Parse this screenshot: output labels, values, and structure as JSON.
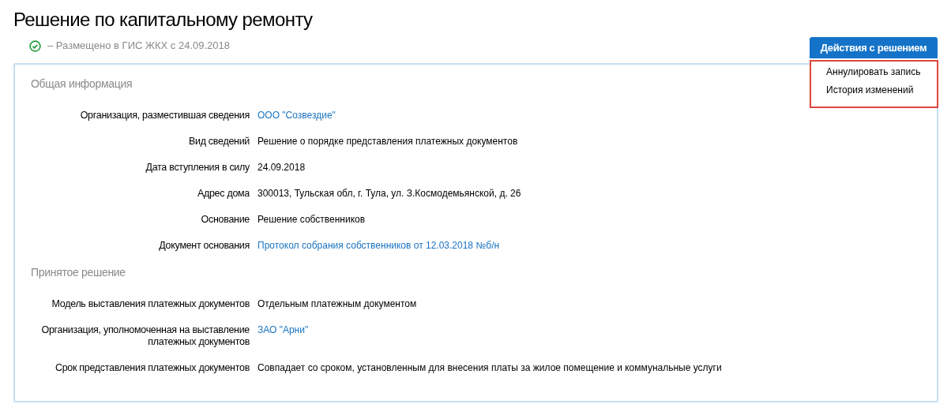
{
  "title": "Решение по капитальному ремонту",
  "status": {
    "placed": true,
    "text": "–  Размещено в ГИС ЖКХ с 24.09.2018"
  },
  "actions": {
    "label": "Действия с решением",
    "expanded": true,
    "items": [
      "Аннулировать запись",
      "История изменений"
    ]
  },
  "sections": [
    {
      "title": "Общая информация",
      "rows": [
        {
          "label": "Организация, разместившая сведения",
          "value": "ООО \"Созвездие\"",
          "kind": "link"
        },
        {
          "label": "Вид сведений",
          "value": "Решение о порядке представления платежных документов",
          "kind": "text"
        },
        {
          "label": "Дата вступления в силу",
          "value": "24.09.2018",
          "kind": "text"
        },
        {
          "label": "Адрес дома",
          "value": "300013, Тульская обл, г. Тула, ул. З.Космодемьянской, д. 26",
          "kind": "text"
        },
        {
          "label": "Основание",
          "value": "Решение собственников",
          "kind": "text"
        },
        {
          "label": "Документ основания",
          "value": "Протокол собрания собственников от 12.03.2018 №б/н",
          "kind": "link"
        }
      ]
    },
    {
      "title": "Принятое решение",
      "rows": [
        {
          "label": "Модель выставления платежных документов",
          "value": "Отдельным платежным документом",
          "kind": "text"
        },
        {
          "label": "Организация, уполномоченная на выставление платежных документов",
          "value": "ЗАО \"Арни\"",
          "kind": "link"
        },
        {
          "label": "Срок представления платежных документов",
          "value": "Совпадает со сроком, установленным для внесения платы за жилое помещение и коммунальные услуги",
          "kind": "text"
        }
      ]
    }
  ]
}
